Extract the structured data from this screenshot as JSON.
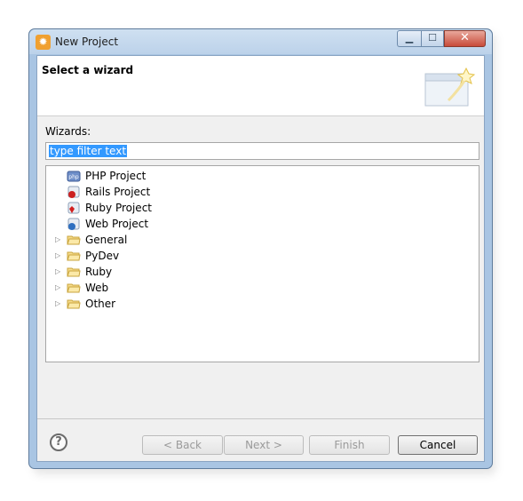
{
  "window": {
    "title": "New Project",
    "controls": [
      "minimize-icon",
      "maximize-icon",
      "close-icon"
    ]
  },
  "header": {
    "title": "Select a wizard"
  },
  "wizards": {
    "label": "Wizards:",
    "filter_text": "type filter text"
  },
  "tree": {
    "items": [
      {
        "label": "PHP Project",
        "icon": "php-project-icon",
        "expandable": false
      },
      {
        "label": "Rails Project",
        "icon": "rails-project-icon",
        "expandable": false
      },
      {
        "label": "Ruby Project",
        "icon": "ruby-project-icon",
        "expandable": false
      },
      {
        "label": "Web Project",
        "icon": "web-project-icon",
        "expandable": false
      },
      {
        "label": "General",
        "icon": "folder-icon",
        "expandable": true
      },
      {
        "label": "PyDev",
        "icon": "folder-icon",
        "expandable": true
      },
      {
        "label": "Ruby",
        "icon": "folder-icon",
        "expandable": true
      },
      {
        "label": "Web",
        "icon": "folder-icon",
        "expandable": true
      },
      {
        "label": "Other",
        "icon": "folder-icon",
        "expandable": true
      }
    ]
  },
  "buttons": {
    "back": "< Back",
    "next": "Next >",
    "finish": "Finish",
    "cancel": "Cancel",
    "help": "?"
  }
}
